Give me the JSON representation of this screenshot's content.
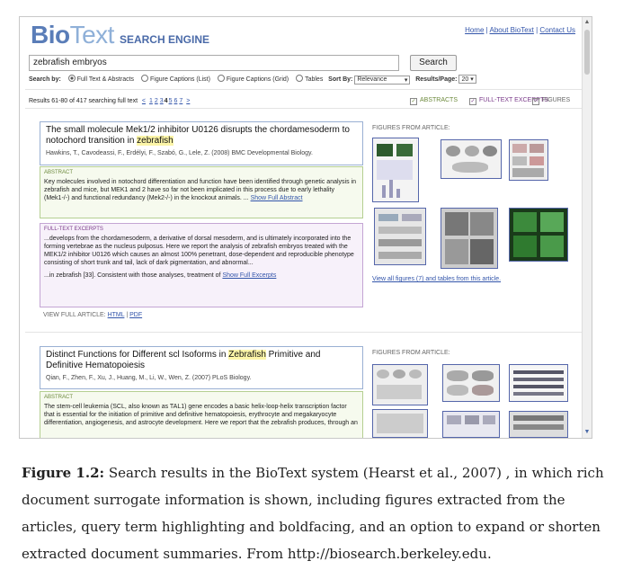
{
  "header": {
    "logo_bio": "Bio",
    "logo_text": "Text",
    "logo_sub": "SEARCH ENGINE",
    "links": [
      "Home",
      "About BioText",
      "Contact Us"
    ]
  },
  "search": {
    "query": "zebrafish embryos",
    "button": "Search",
    "search_by_label": "Search by:",
    "options": [
      "Full Text & Abstracts",
      "Figure Captions (List)",
      "Figure Captions (Grid)",
      "Tables"
    ],
    "sort_label": "Sort By:",
    "sort_value": "Relevance",
    "per_page_label": "Results/Page:",
    "per_page_value": "20"
  },
  "results_bar": {
    "summary": "Results 61-80 of 417 searching full text",
    "prev": "<",
    "pages": [
      "1",
      "2",
      "3",
      "4",
      "5",
      "6",
      "7"
    ],
    "next": ">",
    "abstracts_check": "ABSTRACTS",
    "fulltext_check": "FULL-TEXT EXCERPTS",
    "figures_check": "FIGURES"
  },
  "results": [
    {
      "title_pre": "The small molecule Mek1/2 inhibitor U0126 disrupts the chordamesoderm to notochord transition in ",
      "title_hl": "zebrafish",
      "authors": "Hawkins, T., Cavodeassi, F., Erdélyi, F., Szabó, G., Lele, Z. (2008) BMC Developmental Biology.",
      "abstract_label": "ABSTRACT",
      "abstract_text": "Key molecules involved in notochord differentiation and function have been identified through genetic analysis in zebrafish and mice, but MEK1 and 2 have so far not been implicated in this process due to early lethality (Mek1-/-) and functional redundancy (Mek2-/-) in the knockout animals. ...",
      "abstract_link": "Show Full Abstract",
      "fulltext_label": "FULL-TEXT EXCERPTS",
      "fulltext_text": "...develops from the chordamesoderm, a derivative of dorsal mesoderm, and is ultimately incorporated into the forming vertebrae as the nucleus pulposus. Here we report the analysis of zebrafish embryos treated with the MEK1/2 inhibitor U0126 which causes an almost 100% penetrant, dose-dependent and reproducible phenotype consisting of short trunk and tail, lack of dark pigmentation, and abnormal...",
      "fulltext_text2": "...in zebrafish [33]. Consistent with those analyses, treatment of",
      "fulltext_link": "Show Full Excerpts",
      "view_label": "VIEW FULL ARTICLE:",
      "view_html": "HTML",
      "view_pdf": "PDF",
      "figures_label": "FIGURES FROM ARTICLE:",
      "view_all": "View all figures (7) and tables from this article."
    },
    {
      "title_pre": "Distinct Functions for Different scl Isoforms in ",
      "title_hl": "Zebrafish",
      "title_post": " Primitive and Definitive Hematopoiesis",
      "authors": "Qian, F., Zhen, F., Xu, J., Huang, M., Li, W., Wen, Z. (2007) PLoS Biology.",
      "abstract_label": "ABSTRACT",
      "abstract_text": "The stem-cell leukemia (SCL, also known as TAL1) gene encodes a basic helix-loop-helix transcription factor that is essential for the initiation of primitive and definitive hematopoiesis, erythrocyte and megakaryocyte differentiation, angiogenesis, and astrocyte development. Here we report that the zebrafish produces, through an",
      "figures_label": "FIGURES FROM ARTICLE:"
    }
  ],
  "caption": {
    "label": "Figure 1.2:",
    "text": " Search results in the BioText system (Hearst et al., 2007) , in which rich document surrogate information is shown, including figures extracted from the articles, query term highlighting and boldfacing, and an option to expand or shorten extracted document summaries. From http://biosearch.berkeley.edu."
  }
}
